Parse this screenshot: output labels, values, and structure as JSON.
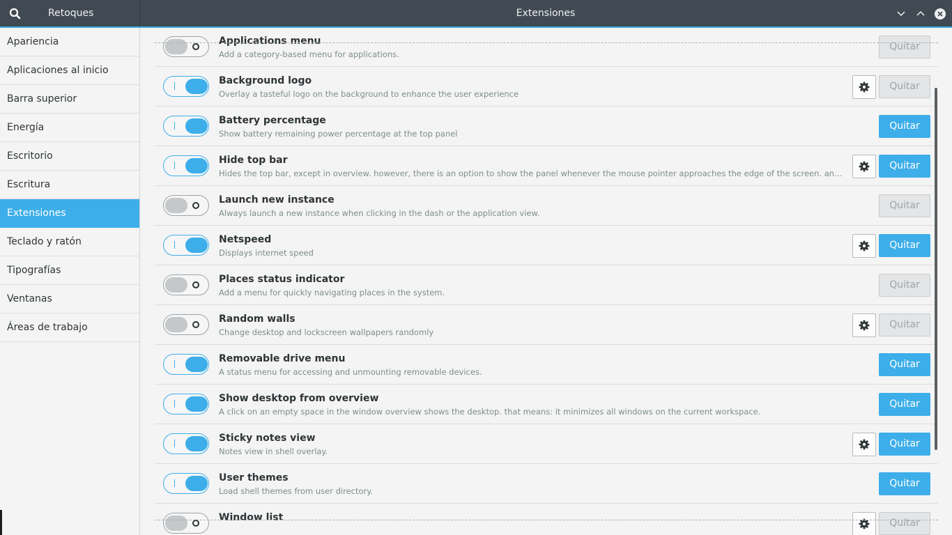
{
  "header": {
    "app_title": "Retoques",
    "window_title": "Extensiones",
    "bg_color": "#414a52",
    "accent": "#3daee9"
  },
  "sidebar": {
    "items": [
      {
        "label": "Apariencia"
      },
      {
        "label": "Aplicaciones al inicio"
      },
      {
        "label": "Barra superior"
      },
      {
        "label": "Energía"
      },
      {
        "label": "Escritorio"
      },
      {
        "label": "Escritura"
      },
      {
        "label": "Extensiones",
        "active": true
      },
      {
        "label": "Teclado y ratón"
      },
      {
        "label": "Tipografías"
      },
      {
        "label": "Ventanas"
      },
      {
        "label": "Áreas de trabajo"
      }
    ]
  },
  "extensions": {
    "remove_label": "Quitar",
    "items": [
      {
        "name": "Applications menu",
        "description": "Add a category-based menu for applications.",
        "enabled": false,
        "has_settings": false
      },
      {
        "name": "Background logo",
        "description": "Overlay a tasteful logo on the background to enhance the user experience",
        "enabled": true,
        "has_settings": true,
        "remove_disabled": true
      },
      {
        "name": "Battery percentage",
        "description": "Show battery remaining power percentage at the top panel",
        "enabled": true,
        "has_settings": false
      },
      {
        "name": "Hide top bar",
        "description": "Hides the top bar, except in overview. however, there is an option to show the panel whenever the mouse pointer approaches the edge of the screen. and if \"intelli...",
        "enabled": true,
        "has_settings": true
      },
      {
        "name": "Launch new instance",
        "description": "Always launch a new instance when clicking in the dash or the application view.",
        "enabled": false,
        "has_settings": false
      },
      {
        "name": "Netspeed",
        "description": "Displays internet speed",
        "enabled": true,
        "has_settings": true
      },
      {
        "name": "Places status indicator",
        "description": "Add a menu for quickly navigating places in the system.",
        "enabled": false,
        "has_settings": false
      },
      {
        "name": "Random walls",
        "description": "Change desktop and lockscreen wallpapers randomly",
        "enabled": false,
        "has_settings": true
      },
      {
        "name": "Removable drive menu",
        "description": "A status menu for accessing and unmounting removable devices.",
        "enabled": true,
        "has_settings": false
      },
      {
        "name": "Show desktop from overview",
        "description": "A click on an empty space in the window overview shows the desktop. that means: it minimizes all windows on the current workspace.",
        "enabled": true,
        "has_settings": false
      },
      {
        "name": "Sticky notes view",
        "description": "Notes view in shell overlay.",
        "enabled": true,
        "has_settings": true
      },
      {
        "name": "User themes",
        "description": "Load shell themes from user directory.",
        "enabled": true,
        "has_settings": false
      },
      {
        "name": "Window list",
        "description": "",
        "enabled": false,
        "has_settings": true
      }
    ]
  }
}
